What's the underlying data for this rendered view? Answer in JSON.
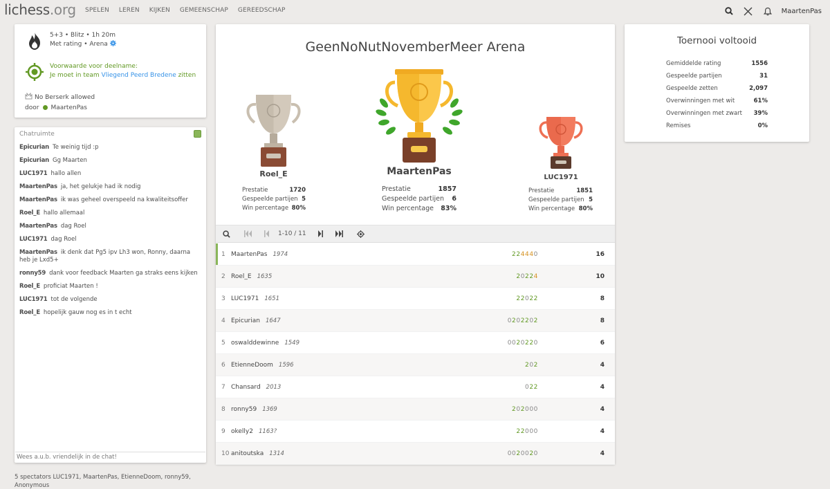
{
  "header": {
    "logo": "lichess",
    "logo_tld": ".org",
    "nav": [
      "SPELEN",
      "LEREN",
      "KIJKEN",
      "GEMEENSCHAP",
      "GEREEDSCHAP"
    ],
    "username": "MaartenPas"
  },
  "info": {
    "line1": "5+3 • Blitz • 1h 20m",
    "line2": "Met rating • Arena",
    "condition_title": "Voorwaarde voor deelname:",
    "condition_prefix": "Je moet in team ",
    "condition_team": "Vliegend Peerd Bredene",
    "condition_suffix": " zitten",
    "berserk": "No Berserk allowed",
    "by_label": "door",
    "by_user": "MaartenPas"
  },
  "chat": {
    "title": "Chatruimte",
    "placeholder": "Wees a.u.b. vriendelijk in de chat!",
    "messages": [
      {
        "user": "Epicurian",
        "text": "Te weinig tijd :p"
      },
      {
        "user": "Epicurian",
        "text": "Gg Maarten"
      },
      {
        "user": "LUC1971",
        "text": "hallo allen"
      },
      {
        "user": "MaartenPas",
        "text": "ja, het gelukje had ik nodig"
      },
      {
        "user": "MaartenPas",
        "text": "ik was geheel overspeeld na kwaliteitsoffer"
      },
      {
        "user": "Roel_E",
        "text": "hallo allemaal"
      },
      {
        "user": "MaartenPas",
        "text": "dag Roel"
      },
      {
        "user": "LUC1971",
        "text": "dag Roel"
      },
      {
        "user": "MaartenPas",
        "text": "ik denk dat Pg5 ipv Lh3 won, Ronny, daarna heb je Lxd5+"
      },
      {
        "user": "ronny59",
        "text": "dank voor feedback Maarten ga straks eens kijken"
      },
      {
        "user": "Roel_E",
        "text": "proficiat Maarten !"
      },
      {
        "user": "LUC1971",
        "text": "tot de volgende"
      },
      {
        "user": "Roel_E",
        "text": "hopelijk gauw nog es in t echt"
      }
    ]
  },
  "spectators": "5 spectators LUC1971, MaartenPas, EtienneDoom, ronny59, Anonymous",
  "tournament": {
    "title": "GeenNoNutNovemberMeer Arena",
    "podium": [
      {
        "name": "Roel_E",
        "perf_label": "Prestatie",
        "perf": "1720",
        "games_label": "Gespeelde partijen",
        "games": "5",
        "win_label": "Win percentage",
        "win": "80%"
      },
      {
        "name": "MaartenPas",
        "perf_label": "Prestatie",
        "perf": "1857",
        "games_label": "Gespeelde partijen",
        "games": "6",
        "win_label": "Win percentage",
        "win": "83%"
      },
      {
        "name": "LUC1971",
        "perf_label": "Prestatie",
        "perf": "1851",
        "games_label": "Gespeelde partijen",
        "games": "5",
        "win_label": "Win percentage",
        "win": "80%"
      }
    ],
    "pager": "1-10 / 11",
    "standings": [
      {
        "rank": "1",
        "name": "MaartenPas",
        "rating": "1974",
        "sheet": "224440",
        "score": "16"
      },
      {
        "rank": "2",
        "name": "Roel_E",
        "rating": "1635",
        "sheet": "20224",
        "score": "10"
      },
      {
        "rank": "3",
        "name": "LUC1971",
        "rating": "1651",
        "sheet": "22022",
        "score": "8"
      },
      {
        "rank": "4",
        "name": "Epicurian",
        "rating": "1647",
        "sheet": "0202202",
        "score": "8"
      },
      {
        "rank": "5",
        "name": "oswalddewinne",
        "rating": "1549",
        "sheet": "0020220",
        "score": "6"
      },
      {
        "rank": "6",
        "name": "EtienneDoom",
        "rating": "1596",
        "sheet": "202",
        "score": "4"
      },
      {
        "rank": "7",
        "name": "Chansard",
        "rating": "2013",
        "sheet": "022",
        "score": "4"
      },
      {
        "rank": "8",
        "name": "ronny59",
        "rating": "1369",
        "sheet": "202000",
        "score": "4"
      },
      {
        "rank": "9",
        "name": "okelly2",
        "rating": "1163?",
        "sheet": "22000",
        "score": "4"
      },
      {
        "rank": "10",
        "name": "anitoutska",
        "rating": "1314",
        "sheet": "0020020",
        "score": "4"
      }
    ]
  },
  "stats": {
    "title": "Toernooi voltooid",
    "rows": [
      {
        "label": "Gemiddelde rating",
        "value": "1556"
      },
      {
        "label": "Gespeelde partijen",
        "value": "31"
      },
      {
        "label": "Gespeelde zetten",
        "value": "2,097"
      },
      {
        "label": "Overwinningen met wit",
        "value": "61%"
      },
      {
        "label": "Overwinningen met zwart",
        "value": "39%"
      },
      {
        "label": "Remises",
        "value": "0%"
      }
    ]
  },
  "colors": {
    "accent": "#629924",
    "link": "#3692e7",
    "gold": "#f5b82e",
    "silver": "#cfc5b7",
    "bronze": "#ee7054",
    "base": "#7a4a33"
  }
}
